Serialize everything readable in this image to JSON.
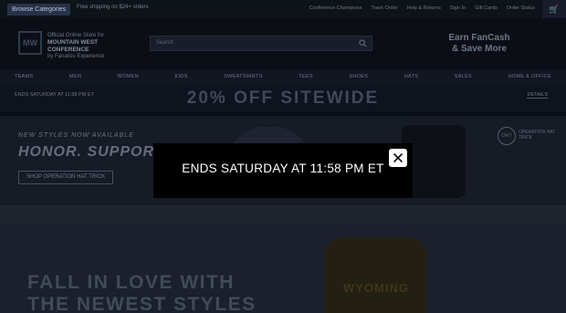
{
  "topbar": {
    "cta_label": "Browse Categories",
    "note": "Free shipping on $24+ orders",
    "links": [
      "Conference Champions",
      "Track Order",
      "Help & Returns",
      "Sign In",
      "Gift Cards",
      "Order Status"
    ],
    "cart_icon": "cart-icon"
  },
  "header": {
    "logo_mark": "MW",
    "logo_line1": "Official Online Store for",
    "logo_line2": "MOUNTAIN WEST CONFERENCE",
    "logo_line3": "by Fanatics Experience",
    "search_placeholder": "Search",
    "fancash_line1": "Earn FanCash",
    "fancash_line2": "& Save More"
  },
  "nav": {
    "items": [
      "TEAMS",
      "MEN",
      "WOMEN",
      "KIDS",
      "SWEATSHIRTS",
      "TEES",
      "SHOES",
      "HATS",
      "SALES",
      "HOME & OFFICE"
    ]
  },
  "promo": {
    "ends_text": "ENDS SATURDAY AT 11:58 PM ET",
    "headline": "20% OFF SITEWIDE",
    "details_link": "DETAILS"
  },
  "hero": {
    "line1": "NEW STYLES NOW AVAILABLE",
    "line2": "HONOR. SUPPORT. RESPECT.",
    "shop_button": "SHOP OPERATION HAT TRICK",
    "badge": "OHT",
    "badge_text": "OPERATION HAT TRICK"
  },
  "hero2": {
    "line1": "FALL IN LOVE WITH",
    "line2": "THE NEWEST STYLES",
    "hoodie_text": "WYOMING"
  },
  "modal": {
    "message": "ENDS SATURDAY AT 11:58 PM ET",
    "close_icon": "close-icon"
  }
}
